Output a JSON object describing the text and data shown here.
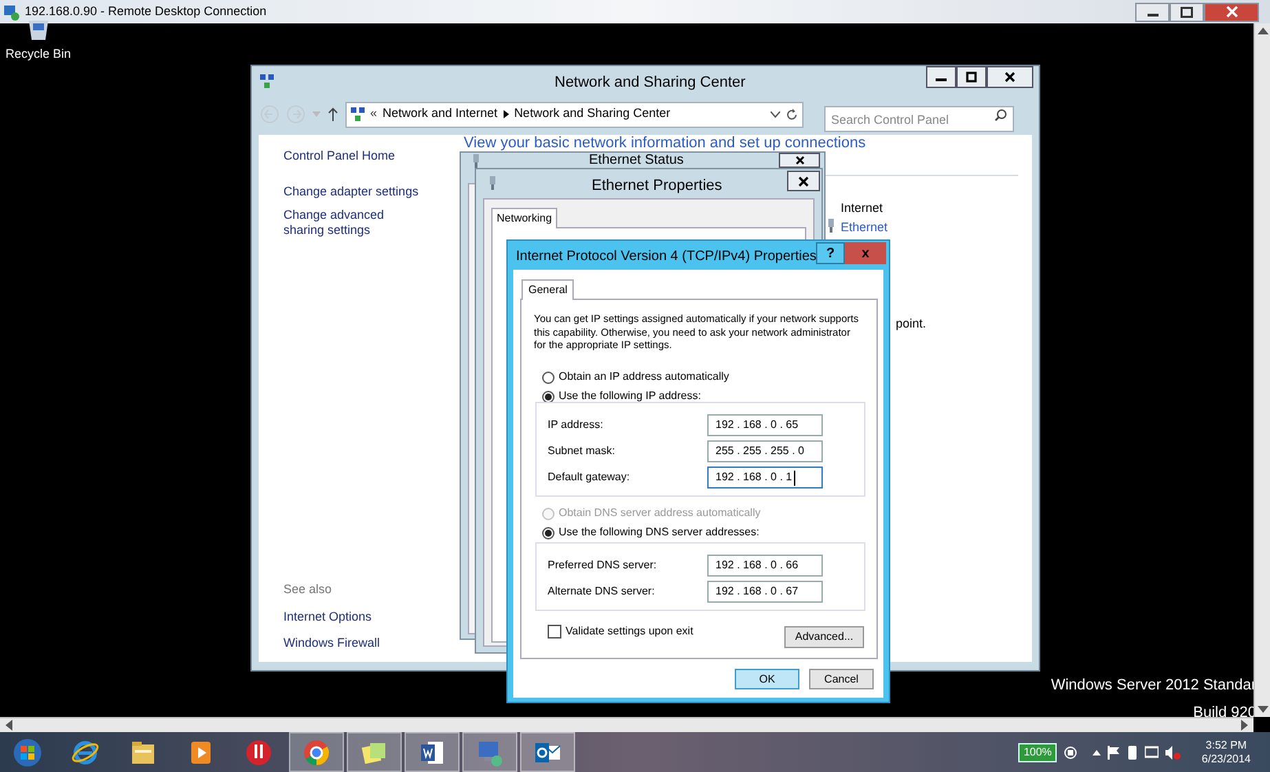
{
  "rdc": {
    "title": "192.168.0.90 - Remote Desktop Connection"
  },
  "desktop_icons": [
    {
      "label": "Recycle Bin"
    }
  ],
  "nsc": {
    "title": "Network and Sharing Center",
    "breadcrumb_prefix": "«",
    "breadcrumb": [
      "Network and Internet",
      "Network and Sharing Center"
    ],
    "search": {
      "placeholder": "Search Control Panel"
    },
    "sidebar": {
      "links": [
        "Control Panel Home",
        "Change adapter settings",
        "Change advanced sharing settings"
      ],
      "see_also": "See also",
      "see_also_links": [
        "Internet Options",
        "Windows Firewall"
      ]
    },
    "heading": "View your basic network information and set up connections",
    "internet_label": "Internet",
    "ethernet_link": "Ethernet",
    "tail_text": "point."
  },
  "ethernet_status": {
    "title": "Ethernet Status"
  },
  "ethernet_properties": {
    "title": "Ethernet Properties",
    "tabs": [
      {
        "label": "Networking",
        "selected": true
      }
    ]
  },
  "ipv4": {
    "title": "Internet Protocol Version 4 (TCP/IPv4) Properties",
    "help": "?",
    "close": "x",
    "tabs": [
      {
        "label": "General",
        "selected": true
      }
    ],
    "intro": "You can get IP settings assigned automatically if your network supports this capability. Otherwise, you need to ask your network administrator for the appropriate IP settings.",
    "ip_options": [
      {
        "label": "Obtain an IP address automatically",
        "selected": false,
        "disabled": false
      },
      {
        "label": "Use the following IP address:",
        "selected": true,
        "disabled": false
      }
    ],
    "ip_fields": [
      {
        "label": "IP address:",
        "value": "192 . 168 . 0 . 65",
        "focused": false
      },
      {
        "label": "Subnet mask:",
        "value": "255 . 255 . 255 . 0",
        "focused": false
      },
      {
        "label": "Default gateway:",
        "value": "192 . 168 . 0 . 1",
        "focused": true
      }
    ],
    "dns_options": [
      {
        "label": "Obtain DNS server address automatically",
        "selected": false,
        "disabled": true
      },
      {
        "label": "Use the following DNS server addresses:",
        "selected": true,
        "disabled": false
      }
    ],
    "dns_fields": [
      {
        "label": "Preferred DNS server:",
        "value": "192 . 168 . 0 . 66",
        "focused": false
      },
      {
        "label": "Alternate DNS server:",
        "value": "192 . 168 . 0 . 67",
        "focused": false
      }
    ],
    "validate": {
      "label": "Validate settings upon exit",
      "checked": false
    },
    "advanced": "Advanced...",
    "buttons": [
      {
        "label": "OK",
        "default": true
      },
      {
        "label": "Cancel",
        "default": false
      }
    ]
  },
  "desktop_text": [
    "Windows Server 2012 Standar",
    "Build 920"
  ],
  "taskbar": {
    "apps": [
      {
        "kind": "start",
        "running": false
      },
      {
        "kind": "ie",
        "running": false
      },
      {
        "kind": "explorer",
        "running": false
      },
      {
        "kind": "media",
        "running": false
      },
      {
        "kind": "app",
        "running": false
      },
      {
        "kind": "chrome",
        "running": true
      },
      {
        "kind": "notes",
        "running": true
      },
      {
        "kind": "word",
        "running": true
      },
      {
        "kind": "network",
        "running": true
      },
      {
        "kind": "outlook",
        "running": true
      }
    ],
    "battery": "100%",
    "time": "3:52 PM",
    "date": "6/23/2014"
  }
}
